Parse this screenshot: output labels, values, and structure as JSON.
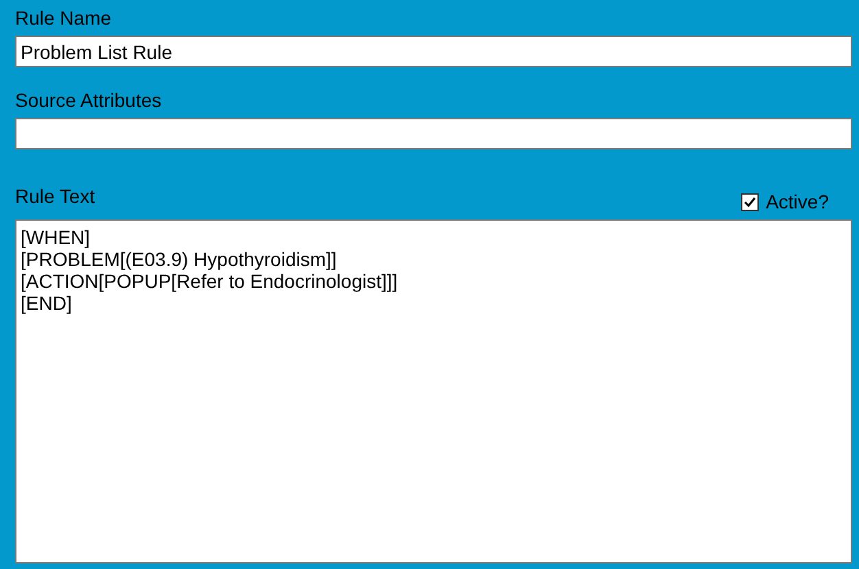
{
  "rule_name": {
    "label": "Rule Name",
    "value": "Problem List Rule"
  },
  "source_attributes": {
    "label": "Source Attributes"
  },
  "rule_text": {
    "label": "Rule Text",
    "lines": [
      "[WHEN]",
      "[PROBLEM[(E03.9) Hypothyroidism]]",
      "[ACTION[POPUP[Refer to Endocrinologist]]]",
      "[END]"
    ]
  },
  "active": {
    "label": "Active?",
    "checked": true
  }
}
